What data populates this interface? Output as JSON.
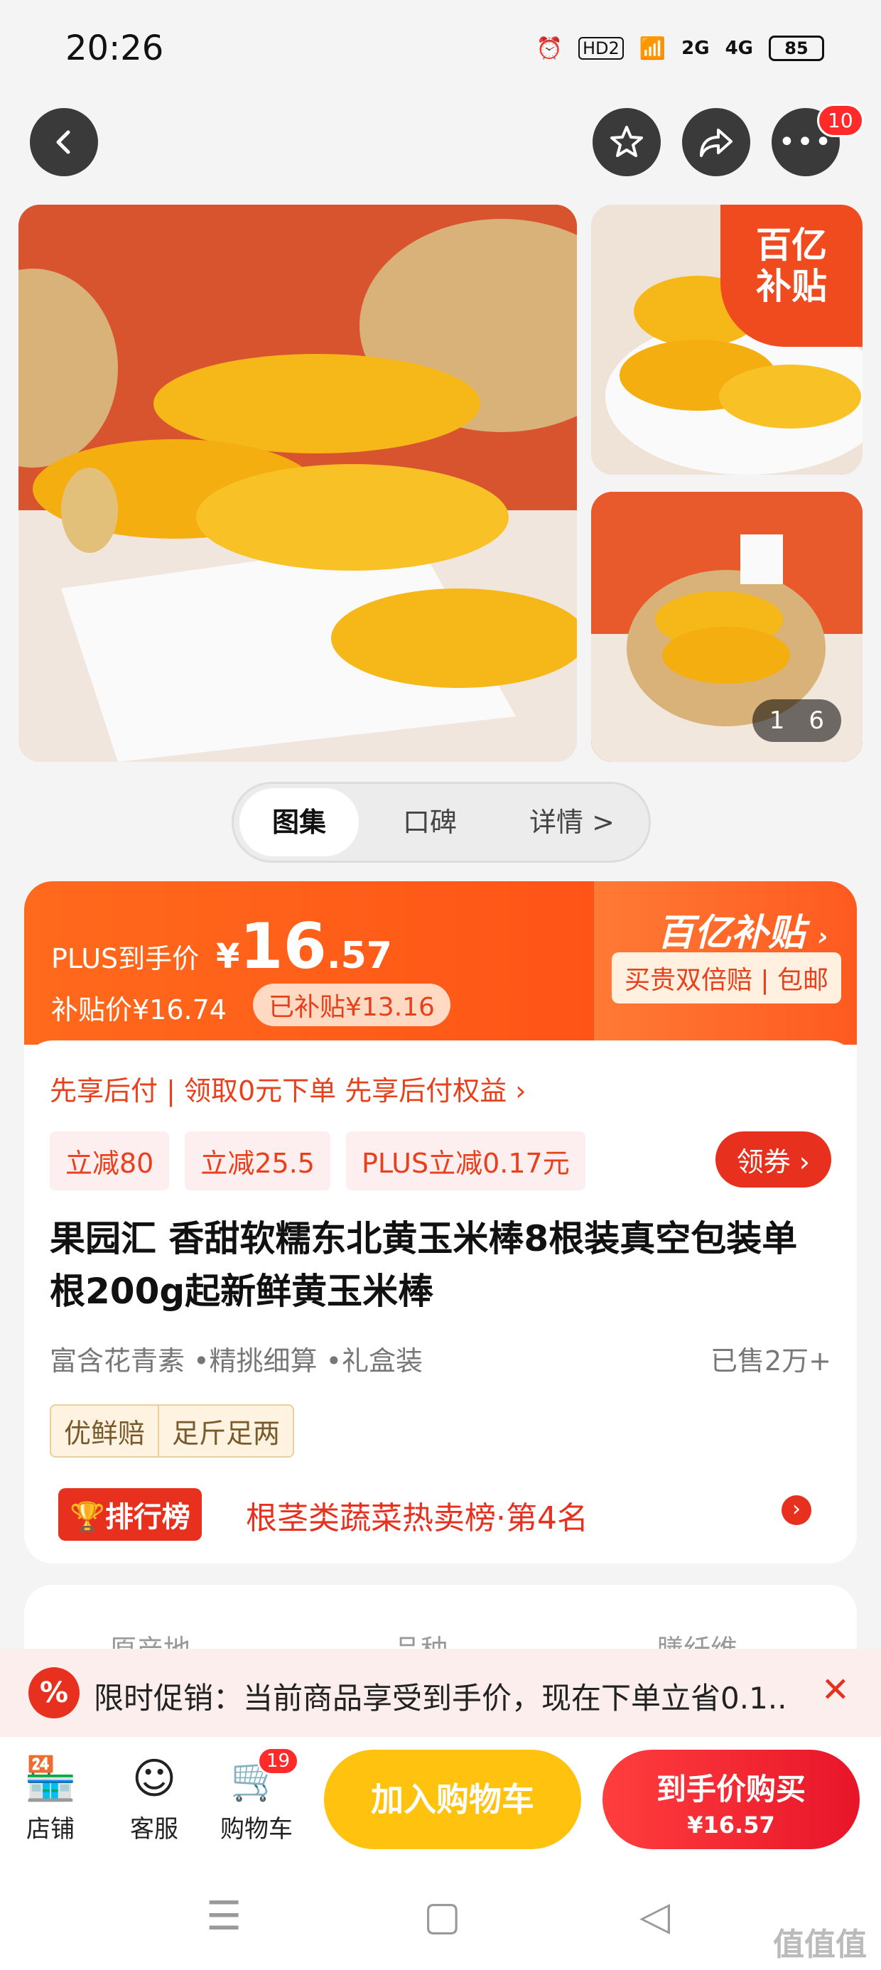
{
  "status_bar": {
    "time": "20:26",
    "battery": "85",
    "network_1": "2G",
    "network_2": "4G",
    "hd": "HD2"
  },
  "nav": {
    "more_badge": "10"
  },
  "gallery": {
    "counter_current": "1",
    "counter_total": "6",
    "subsidy_badge_line1": "百亿",
    "subsidy_badge_line2": "补贴"
  },
  "tabs": [
    {
      "label": "图集"
    },
    {
      "label": "口碑"
    },
    {
      "label": "详情 >"
    }
  ],
  "price": {
    "plus_label": "PLUS到手价",
    "currency": "¥",
    "integer": "16",
    "decimal": ".57",
    "subsidy_price": "补贴价¥16.74",
    "subsidy_amount": "已补贴¥13.16",
    "program_title": "百亿补贴",
    "program_sub": "买贵双倍赔 | 包邮"
  },
  "after_pay": "先享后付 | 领取0元下单 先享后付权益 ›",
  "coupons": [
    "立减80",
    "立减25.5",
    "PLUS立减0.17元"
  ],
  "get_coupon": "领券",
  "product_title": "果园汇 香甜软糯东北黄玉米棒8根装真空包装单根200g起新鲜黄玉米棒",
  "features": "富含花青素 •精挑细算 •礼盒装",
  "sold": "已售2万+",
  "tags": [
    "优鲜赔",
    "足斤足两"
  ],
  "rank": {
    "label": "排行榜",
    "text": "根茎类蔬菜热卖榜·第4名"
  },
  "attributes": [
    "原产地",
    "品种",
    "膳纤维"
  ],
  "promo": {
    "icon": "%",
    "text": "限时促销：当前商品享受到手价，现在下单立省0.1..."
  },
  "bottom": {
    "store": "店铺",
    "service": "客服",
    "cart": "购物车",
    "cart_badge": "19",
    "add_cart": "加入购物车",
    "buy_line1": "到手价购买",
    "buy_line2": "¥16.57"
  },
  "watermark": "值值值",
  "colors": {
    "accent": "#ff4a14",
    "red": "#e8301e",
    "yellow": "#ffc20e"
  }
}
